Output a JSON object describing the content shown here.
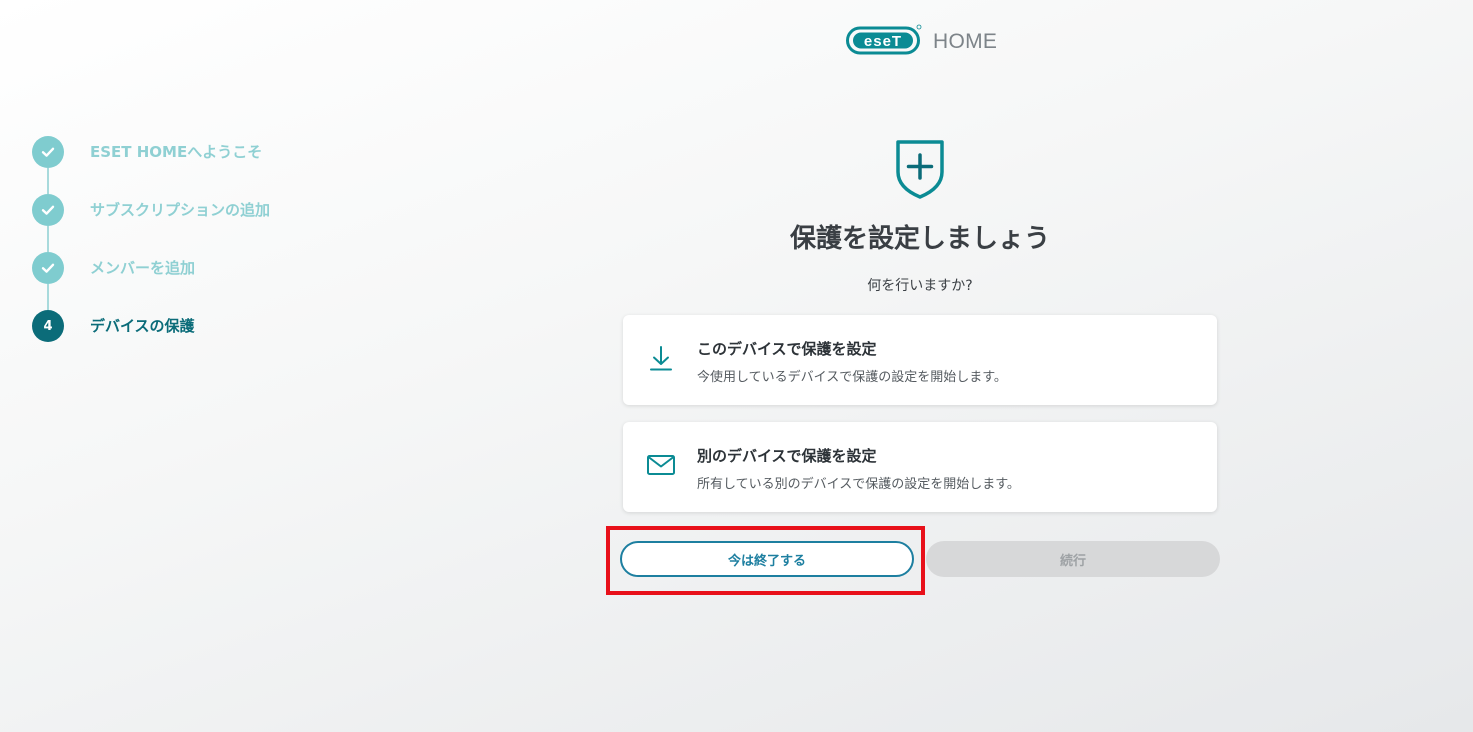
{
  "header": {
    "brand": "ESET",
    "product": "HOME"
  },
  "stepper": {
    "steps": [
      {
        "label": "ESET HOMEへようこそ",
        "state": "done"
      },
      {
        "label": "サブスクリプションの追加",
        "state": "done"
      },
      {
        "label": "メンバーを追加",
        "state": "done"
      },
      {
        "label": "デバイスの保護",
        "state": "current",
        "number": "4"
      }
    ]
  },
  "main": {
    "icon": "shield-plus-icon",
    "title": "保護を設定しましょう",
    "subtitle": "何を行いますか?",
    "options": [
      {
        "icon": "download-icon",
        "title": "このデバイスで保護を設定",
        "description": "今使用しているデバイスで保護の設定を開始します。"
      },
      {
        "icon": "mail-icon",
        "title": "別のデバイスで保護を設定",
        "description": "所有している別のデバイスで保護の設定を開始します。"
      }
    ],
    "buttons": {
      "later": "今は終了する",
      "continue": "続行"
    }
  },
  "colors": {
    "accent": "#0b6c79",
    "accent_light": "#7fcccf",
    "button_border": "#1d7fa0",
    "disabled": "#d7d8d9",
    "highlight": "#e8101a"
  }
}
